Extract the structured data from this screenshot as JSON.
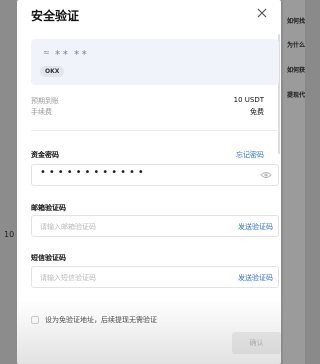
{
  "background": {
    "right_panel_items": [
      "如何找",
      "为什么",
      "如何获",
      "提现代"
    ],
    "left_number": "10"
  },
  "modal": {
    "title": "安全验证",
    "close_icon": "close-icon",
    "account": {
      "masked_name": "≈ ∗∗ ∗∗",
      "tag": "OKX"
    },
    "details": [
      {
        "label": "预期到账",
        "value": "10 USDT"
      },
      {
        "label": "手续费",
        "value": "免费"
      }
    ],
    "fund_password": {
      "label": "资金密码",
      "forgot_link": "忘记密码",
      "value_dots": "••••••••••••",
      "eye_icon": "eye-icon"
    },
    "email_code": {
      "label": "邮箱验证码",
      "placeholder": "请输入邮箱验证码",
      "send_label": "发送验证码"
    },
    "sms_code": {
      "label": "短信验证码",
      "placeholder": "请输入短信验证码",
      "send_label": "发送验证码"
    },
    "checkbox_label": "设为免验证地址，后续提现无需验证",
    "confirm_label": "确认"
  },
  "colors": {
    "accent": "#2f6fe0",
    "backdrop": "#8c8c8c"
  }
}
